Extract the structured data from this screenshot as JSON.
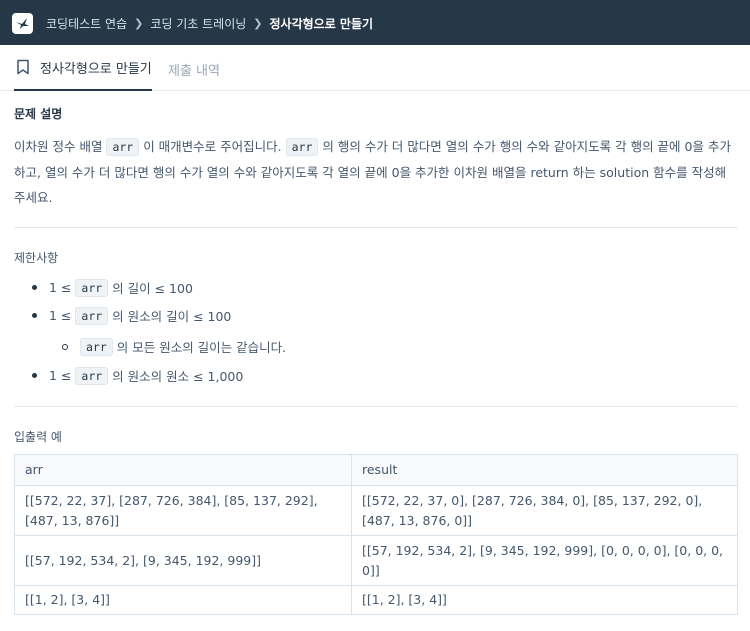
{
  "header": {
    "crumbs": [
      "코딩테스트 연습",
      "코딩 기초 트레이닝",
      "정사각형으로 만들기"
    ]
  },
  "tabs": {
    "active": "정사각형으로 만들기",
    "history": "제출 내역"
  },
  "problem": {
    "title": "문제 설명",
    "text_1": "이차원 정수 배열",
    "code": "arr",
    "text_2": "이 매개변수로 주어집니다.",
    "text_3": "의 행의 수가 더 많다면 열의 수가 행의 수와 같아지도록 각 행의 끝에 0을 추가하고, 열의 수가 더 많다면 행의 수가 열의 수와 같아지도록 각 열의 끝에 0을 추가한 이차원 배열을 return 하는 solution 함수를 작성해 주세요."
  },
  "constraints": {
    "title": "제한사항",
    "items": [
      {
        "prefix": "1 ≤",
        "code": "arr",
        "suffix": "의 길이 ≤ 100"
      },
      {
        "prefix": "1 ≤",
        "code": "arr",
        "suffix": "의 원소의 길이 ≤ 100"
      },
      {
        "prefix": "",
        "code": "arr",
        "suffix": "의 모든 원소의 길이는 같습니다."
      },
      {
        "prefix": "1 ≤",
        "code": "arr",
        "suffix": "의 원소의 원소 ≤ 1,000"
      }
    ]
  },
  "examples": {
    "title": "입출력 예",
    "headers": [
      "arr",
      "result"
    ],
    "rows": [
      [
        "[[572, 22, 37], [287, 726, 384], [85, 137, 292], [487, 13, 876]]",
        "[[572, 22, 37, 0], [287, 726, 384, 0], [85, 137, 292, 0], [487, 13, 876, 0]]"
      ],
      [
        "[[57, 192, 534, 2], [9, 345, 192, 999]]",
        "[[57, 192, 534, 2], [9, 345, 192, 999], [0, 0, 0, 0], [0, 0, 0, 0]]"
      ],
      [
        "[[1, 2], [3, 4]]",
        "[[1, 2], [3, 4]]"
      ]
    ]
  }
}
